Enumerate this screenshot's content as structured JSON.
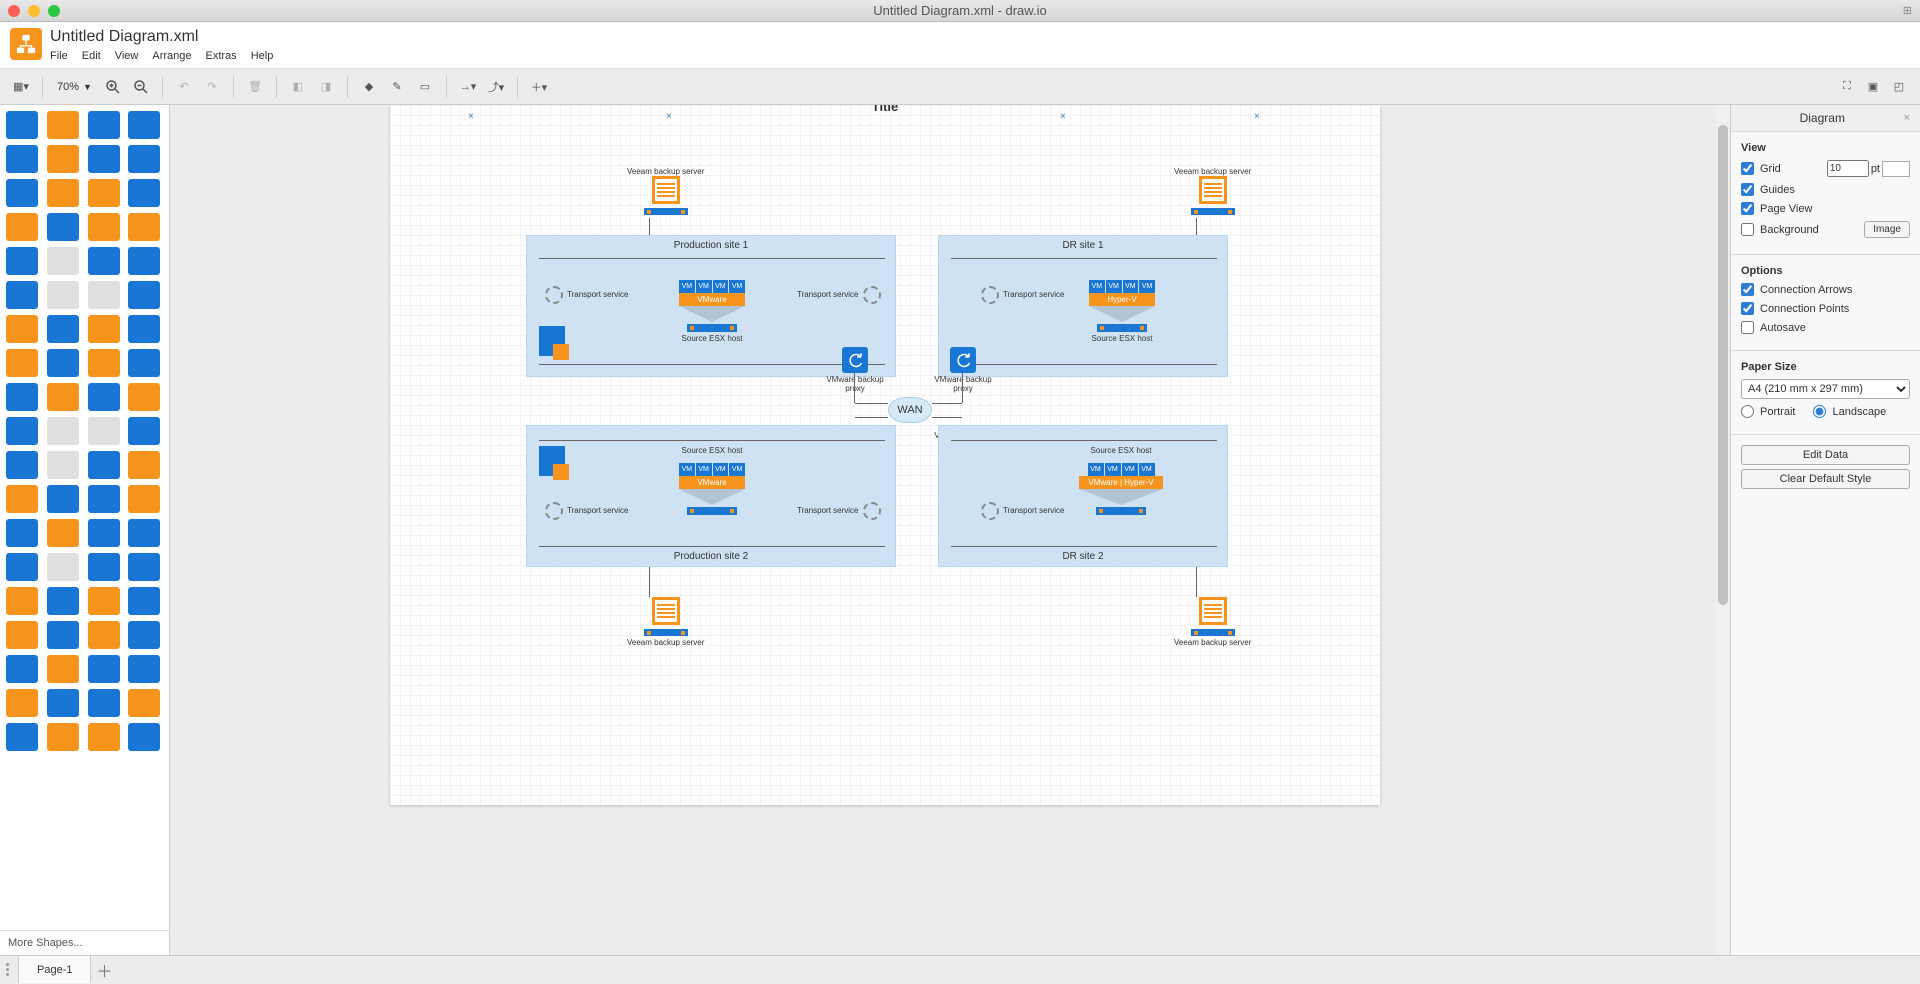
{
  "window_title": "Untitled Diagram.xml - draw.io",
  "document_title": "Untitled Diagram.xml",
  "menubar": [
    "File",
    "Edit",
    "View",
    "Arrange",
    "Extras",
    "Help"
  ],
  "toolbar": {
    "zoom": "70%"
  },
  "shapes_panel": {
    "more_shapes": "More Shapes..."
  },
  "diagram": {
    "title_text": "Title",
    "wan": "WAN",
    "sites": {
      "prod1": {
        "title": "Production site 1",
        "hv": "VMware",
        "host": "Source ESX host"
      },
      "dr1": {
        "title": "DR site 1",
        "hv": "Hyper-V",
        "host": "Source ESX host"
      },
      "prod2": {
        "title": "Production site 2",
        "hv": "VMware",
        "host": "Source ESX host"
      },
      "dr2": {
        "title": "DR site 2",
        "hv": "VMware | Hyper-V",
        "host": "Source ESX host"
      }
    },
    "transport": "Transport\nservice",
    "proxy_label": "VMware\nbackup proxy",
    "veeam_label": "Veeam backup server"
  },
  "right_panel": {
    "title": "Diagram",
    "view_h": "View",
    "grid": "Grid",
    "grid_size": "10",
    "grid_unit": "pt",
    "guides": "Guides",
    "page_view": "Page View",
    "background": "Background",
    "image_btn": "Image",
    "options_h": "Options",
    "conn_arrows": "Connection Arrows",
    "conn_points": "Connection Points",
    "autosave": "Autosave",
    "paper_h": "Paper Size",
    "paper_size": "A4 (210 mm x 297 mm)",
    "portrait": "Portrait",
    "landscape": "Landscape",
    "edit_data": "Edit Data",
    "clear_style": "Clear Default Style"
  },
  "footer": {
    "page_tab": "Page-1"
  }
}
